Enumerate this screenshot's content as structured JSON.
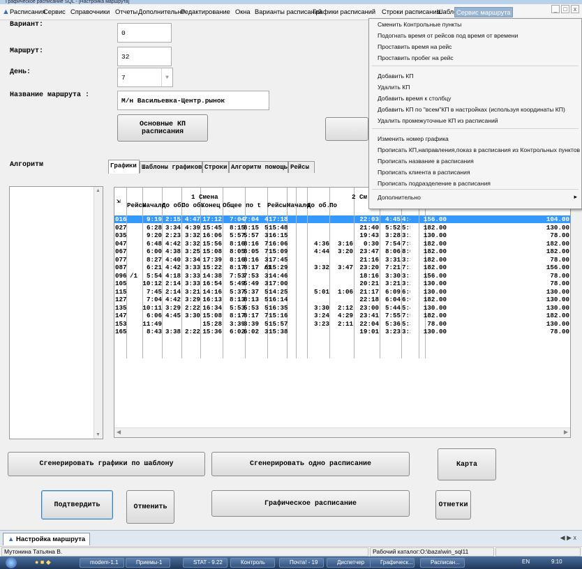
{
  "window": {
    "title": "Графическое расписание SQL - [Настройка маршрута]"
  },
  "menu": {
    "items": [
      "Расписания",
      "Сервис",
      "Справочники",
      "Отчеты",
      "Дополнительно",
      "Редактирование",
      "Окна",
      "Варианты расписаний",
      "Графики расписаний",
      "Строки расписания",
      "Шаблоны",
      "Сервис маршрута"
    ],
    "active": "Сервис маршрута"
  },
  "form": {
    "variant_label": "Вариант:",
    "variant_value": "0",
    "route_label": "Маршрут:",
    "route_value": "32",
    "day_label": "День:",
    "day_value": "7",
    "route_name_label": "Название маршрута :",
    "route_name_value": "М/н Васильевка-Центр.рынок",
    "main_kp_button": "Основные КП расписания",
    "algorithm_label": "Алгоритм"
  },
  "tabs": [
    "Графики",
    "Шаблоны графиков",
    "Строки",
    "Алгоритм помощь",
    "Рейсы"
  ],
  "grid": {
    "group1": "1 Смена",
    "group2": "2 См",
    "headers": [
      "Рейсы",
      "Начало",
      "До об.",
      "По об.",
      "Конец",
      "Общее",
      "по t",
      "Рейсы",
      "Начало",
      "До об.",
      "По"
    ],
    "rows": [
      [
        "01",
        "6",
        "",
        "9:19",
        "2:15",
        "4:47",
        "17:12",
        "7:04",
        "7:04",
        "4",
        "",
        "17:18",
        "",
        "",
        "22:03",
        "4:45",
        "4:45",
        "156.00",
        "104.00"
      ],
      [
        "02",
        "7",
        "",
        "6:28",
        "3:34",
        "4:39",
        "15:45",
        "8:15",
        "8:15",
        "5",
        "",
        "15:48",
        "",
        "",
        "21:40",
        "5:52",
        "5:52",
        "182.00",
        "130.00"
      ],
      [
        "03",
        "5",
        "",
        "9:20",
        "2:23",
        "3:32",
        "16:06",
        "5:57",
        "5:57",
        "3",
        "",
        "16:15",
        "",
        "",
        "19:43",
        "3:28",
        "3:28",
        "130.00",
        "78.00"
      ],
      [
        "04",
        "7",
        "",
        "6:48",
        "4:42",
        "3:32",
        "15:56",
        "8:16",
        "8:16",
        "7",
        "",
        "16:06",
        "4:36",
        "3:16",
        "0:30",
        "7:54",
        "7:54",
        "182.00",
        "182.00"
      ],
      [
        "06",
        "7",
        "",
        "6:00",
        "4:38",
        "3:25",
        "15:08",
        "8:05",
        "8:05",
        "7",
        "",
        "15:09",
        "4:44",
        "3:20",
        "23:47",
        "8:06",
        "8:06",
        "182.00",
        "182.00"
      ],
      [
        "07",
        "7",
        "",
        "8:27",
        "4:40",
        "3:34",
        "17:39",
        "8:16",
        "8:16",
        "3",
        "",
        "17:45",
        "",
        "",
        "21:16",
        "3:31",
        "3:31",
        "182.00",
        "78.00"
      ],
      [
        "08",
        "7",
        "",
        "6:21",
        "4:42",
        "3:33",
        "15:22",
        "8:17",
        "8:17",
        "6",
        "/1",
        "15:29",
        "3:32",
        "3:47",
        "23:20",
        "7:21",
        "7:21",
        "182.00",
        "156.00"
      ],
      [
        "09",
        "6",
        "/1",
        "5:54",
        "4:18",
        "3:33",
        "14:38",
        "7:53",
        "7:53",
        "3",
        "",
        "14:46",
        "",
        "",
        "18:16",
        "3:30",
        "3:30",
        "156.00",
        "78.00"
      ],
      [
        "10",
        "5",
        "",
        "10:12",
        "2:14",
        "3:33",
        "16:54",
        "5:49",
        "5:49",
        "3",
        "",
        "17:00",
        "",
        "",
        "20:21",
        "3:21",
        "3:21",
        "130.00",
        "78.00"
      ],
      [
        "11",
        "5",
        "",
        "7:45",
        "2:14",
        "3:21",
        "14:16",
        "5:37",
        "5:37",
        "5",
        "",
        "14:25",
        "5:01",
        "1:06",
        "21:17",
        "6:09",
        "6:09",
        "130.00",
        "130.00"
      ],
      [
        "12",
        "7",
        "",
        "7:04",
        "4:42",
        "3:29",
        "16:13",
        "8:13",
        "8:13",
        "5",
        "",
        "16:14",
        "",
        "",
        "22:18",
        "6:04",
        "6:04",
        "182.00",
        "130.00"
      ],
      [
        "13",
        "5",
        "",
        "10:11",
        "3:29",
        "2:22",
        "16:34",
        "5:53",
        "5:53",
        "5",
        "",
        "16:35",
        "3:30",
        "2:12",
        "23:00",
        "5:44",
        "5:44",
        "130.00",
        "130.00"
      ],
      [
        "14",
        "7",
        "",
        "6:06",
        "4:45",
        "3:30",
        "15:08",
        "8:17",
        "8:17",
        "7",
        "",
        "15:16",
        "3:24",
        "4:29",
        "23:41",
        "7:55",
        "7:55",
        "182.00",
        "182.00"
      ],
      [
        "15",
        "3",
        "",
        "11:49",
        "",
        "",
        "15:28",
        "3:39",
        "3:39",
        "5",
        "",
        "15:57",
        "3:23",
        "2:11",
        "22:04",
        "5:36",
        "5:36",
        "78.00",
        "130.00"
      ],
      [
        "16",
        "5",
        "",
        "8:43",
        "3:38",
        "2:22",
        "15:36",
        "6:02",
        "6:02",
        "3",
        "",
        "15:38",
        "",
        "",
        "19:01",
        "3:23",
        "3:23",
        "130.00",
        "78.00"
      ]
    ],
    "red_cells": [
      "03:5",
      "03:6",
      "05:4",
      "06:4",
      "07:4",
      "10:12"
    ],
    "selected_row": 0
  },
  "dropdown": {
    "items": [
      "Сменить Контрольные пункты",
      "Подогнать время от рейсов под время от времени",
      "Проставить время  на рейс",
      "Проставить пробег на рейс",
      "Добавить КП",
      "Удалить КП",
      "Добавить время к столбцу",
      "Добавить КП по \"всем\"КП в настройках (используя координаты КП)",
      "Удалить промежуточные КП из расписаний",
      "Изменить номер графика",
      "Прописать КП,направления,показ в расписания из Контрольных пунктов",
      "Прописать название в расписания",
      "Прописать клиента  в расписания",
      "Прописать подразделение  в расписания",
      "Дополнительно"
    ],
    "arrow": "▸"
  },
  "buttons": {
    "gen_by_template": "Сгенерировать графики по шаблону",
    "gen_one": "Сгенерировать одно расписание",
    "map": "Карта",
    "confirm": "Подтвердить",
    "cancel": "Отменить",
    "graphic": "Графическое расписание",
    "marks": "Отметки"
  },
  "mdi_tab": "Настройка маршрута",
  "status": {
    "user": "Мутонина Татьяна В.",
    "workdir": "Рабочий каталог:O:\\baza\\win_sql11"
  },
  "taskbar": {
    "items": [
      "modem-1.1",
      "Приемы-1",
      "STAT - 9.22",
      "Контроль",
      "Почта! - 19",
      "Диспетчер",
      "Графическ...",
      "Расписан..."
    ],
    "lang": "EN",
    "clock": "9:10"
  },
  "colors": {
    "selection": "#3399ff",
    "red": "#e00000",
    "menu_active": "#99b4d1"
  }
}
